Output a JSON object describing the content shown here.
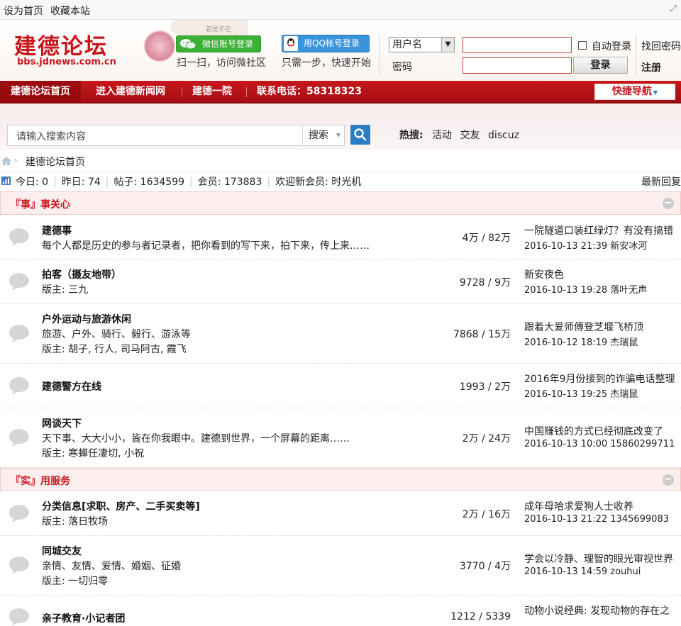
{
  "topbar": {
    "set_home": "设为首页",
    "bookmark": "收藏本站"
  },
  "header": {
    "logo": "建德论坛",
    "logo_url": "bbs.jdnews.com.cn",
    "wechat_btn": "微信账号登录",
    "wechat_sub": "扫一扫，访问微社区",
    "qq_btn": "用QQ帐号登录",
    "qq_sub": "只需一步，快速开始",
    "username_select": "用户名",
    "password_label": "密码",
    "auto_login": "自动登录",
    "login_btn": "登录",
    "forgot": "找回密码",
    "register": "注册",
    "deco_text": "若是不在"
  },
  "nav": {
    "items": [
      "建德论坛首页",
      "进入建德新闻网",
      "建德一院",
      "联系电话：58318323"
    ],
    "quick": "快捷导航"
  },
  "search": {
    "placeholder": "请输入搜索内容",
    "type": "搜索",
    "hot_label": "热搜:",
    "hot": [
      "活动",
      "交友",
      "discuz"
    ]
  },
  "breadcrumb": {
    "text": "建德论坛首页"
  },
  "stats": {
    "today": "今日: 0",
    "yesterday": "昨日: 74",
    "posts": "帖子: 1634599",
    "members": "会员: 173883",
    "newest": "欢迎新会员: 时光机",
    "latest_reply": "最新回复"
  },
  "categories": [
    {
      "title": "『事』事关心"
    },
    {
      "title": "『实』用服务"
    }
  ],
  "forums": [
    {
      "title": "建德事",
      "line2": "每个人都是历史的参与者记录者，把你看到的写下来，拍下来，传上来……",
      "line3": "",
      "counts": "4万 / 82万",
      "last_title": "一院隧道口装红绿灯？有没有搞错",
      "last_meta": "2016-10-13 21:39 新安冰河"
    },
    {
      "title": "拍客（摄友地带）",
      "line2": "版主: 三九",
      "line3": "",
      "counts": "9728 / 9万",
      "last_title": "新安夜色",
      "last_meta": "2016-10-13 19:28 落叶无声"
    },
    {
      "title": "户外运动与旅游休闲",
      "line2": "旅游、户外、骑行、毅行、游泳等",
      "line3": "版主: 胡子, 行人, 司马阿古, 霞飞",
      "counts": "7868 / 15万",
      "last_title": "跟着大爱师傅登芝堰飞桥顶",
      "last_meta": "2016-10-12 18:19 杰瑞鼠"
    },
    {
      "title": "建德警方在线",
      "line2": "",
      "line3": "",
      "counts": "1993 / 2万",
      "last_title": "2016年9月份接到的诈骗电话整理",
      "last_meta": "2016-10-13 19:25 杰瑞鼠"
    },
    {
      "title": "网谈天下",
      "line2": "天下事、大大小小，皆在你我眼中。建德到世界，一个屏幕的距离……",
      "line3": "版主: 寒蝉任凄切, 小祝",
      "counts": "2万 / 24万",
      "last_title": "中国赚钱的方式已经彻底改变了",
      "last_meta": "2016-10-13 10:00 15860299711"
    },
    {
      "title": "分类信息[求职、房产、二手买卖等]",
      "line2": "版主: 落日牧场",
      "line3": "",
      "counts": "2万 / 16万",
      "last_title": "成年母哈求爱狗人士收养",
      "last_meta": "2016-10-13 21:22 1345699083"
    },
    {
      "title": "同城交友",
      "line2": "亲情、友情、爱情、婚姻、征婚",
      "line3": "版主: 一切归零",
      "counts": "3770 / 4万",
      "last_title": "学会以冷静、理智的眼光审视世界",
      "last_meta": "2016-10-13 14:59 zouhui"
    },
    {
      "title": "亲子教育·小记者团",
      "line2": "",
      "line3": "",
      "counts": "1212 / 5339",
      "last_title": "动物小说经典: 发现动物的存在之",
      "last_meta": ""
    }
  ]
}
